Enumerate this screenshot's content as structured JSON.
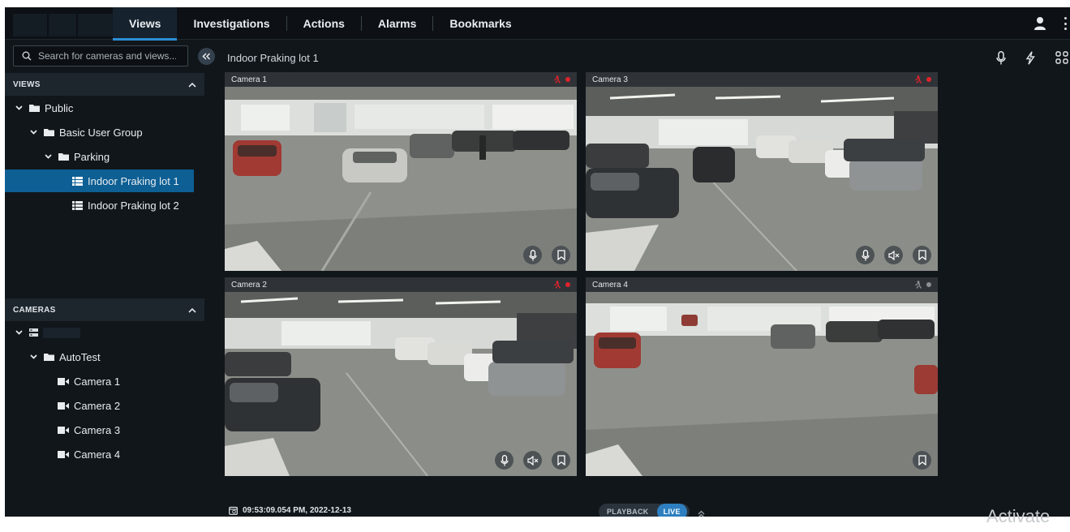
{
  "nav": {
    "tabs": [
      {
        "label": "Views",
        "active": true
      },
      {
        "label": "Investigations"
      },
      {
        "label": "Actions"
      },
      {
        "label": "Alarms"
      },
      {
        "label": "Bookmarks"
      }
    ]
  },
  "sidebar": {
    "search_placeholder": "Search for cameras and views...",
    "views_header": "VIEWS",
    "views_tree": [
      "Public",
      "Basic User Group",
      "Parking",
      "Indoor Praking lot 1",
      "Indoor Praking lot 2"
    ],
    "selected_view": "Indoor Praking lot 1",
    "cameras_header": "CAMERAS",
    "cameras_tree": [
      "AutoTest",
      "Camera 1",
      "Camera 2",
      "Camera 3",
      "Camera 4"
    ]
  },
  "main": {
    "view_title": "Indoor Praking lot 1",
    "tiles": [
      {
        "label": "Camera 1",
        "recording": true
      },
      {
        "label": "Camera 3",
        "recording": true
      },
      {
        "label": "Camera 2",
        "recording": true
      },
      {
        "label": "Camera 4",
        "recording": false
      }
    ],
    "timestamp": "09:53:09.054 PM, 2022-12-13",
    "mode_playback": "PLAYBACK",
    "mode_live": "LIVE",
    "active_mode": "LIVE"
  },
  "colors": {
    "accent": "#2d8fd5",
    "selected": "#0d5f94",
    "recording": "#e0222b",
    "idle": "#8a9096"
  },
  "watermark": "Activate"
}
